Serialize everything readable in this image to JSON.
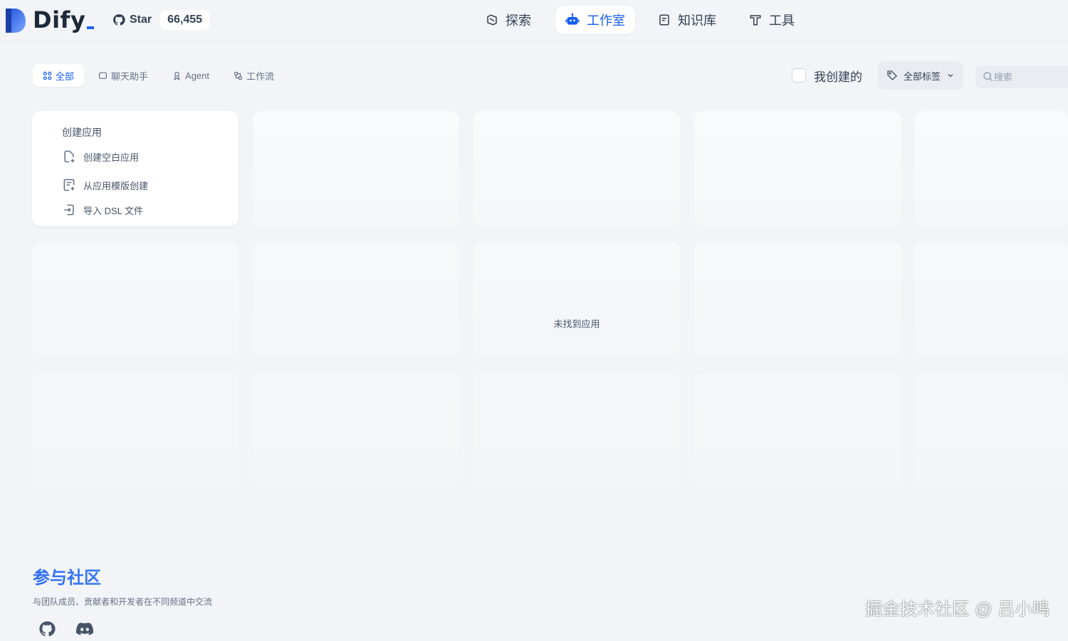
{
  "header": {
    "logo_text": "Dify",
    "github_star_label": "Star",
    "github_star_count": "66,455",
    "nav": [
      {
        "label": "探索",
        "icon": "compass-icon"
      },
      {
        "label": "工作室",
        "icon": "robot-icon"
      },
      {
        "label": "知识库",
        "icon": "book-icon"
      },
      {
        "label": "工具",
        "icon": "hammer-icon"
      }
    ],
    "active_nav": "工作室"
  },
  "filters": {
    "tabs": [
      {
        "label": "全部",
        "icon": "grid-icon"
      },
      {
        "label": "聊天助手",
        "icon": "chat-icon"
      },
      {
        "label": "Agent",
        "icon": "agent-icon"
      },
      {
        "label": "工作流",
        "icon": "workflow-icon"
      }
    ],
    "active_tab": "全部",
    "mine_label": "我创建的",
    "tags_label": "全部标签",
    "search_placeholder": "搜索"
  },
  "create_card": {
    "title": "创建应用",
    "items": [
      {
        "label": "创建空白应用",
        "icon": "file-plus-icon"
      },
      {
        "label": "从应用模版创建",
        "icon": "template-icon"
      },
      {
        "label": "导入 DSL 文件",
        "icon": "import-icon"
      }
    ]
  },
  "empty_state": "未找到应用",
  "community": {
    "title": "参与社区",
    "description": "与团队成员、贡献者和开发者在不同频道中交流",
    "icons": [
      "github-icon",
      "discord-icon"
    ]
  },
  "watermark": "掘金技术社区 @ 吕小鸣",
  "colors": {
    "accent": "#155eef",
    "background": "#f2f4f7",
    "card": "#ffffff"
  }
}
